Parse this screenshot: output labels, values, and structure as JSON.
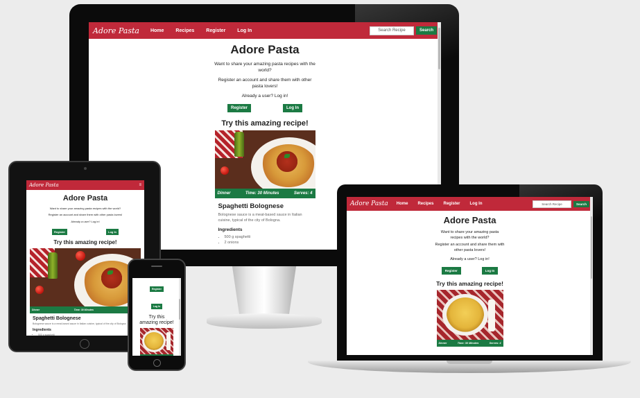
{
  "brand": "Adore Pasta",
  "nav": {
    "home": "Home",
    "recipes": "Recipes",
    "register": "Register",
    "login": "Log In"
  },
  "search": {
    "placeholder": "Search Recipe",
    "button": "Search"
  },
  "hero": {
    "title": "Adore Pasta",
    "intro": "Want to share your amazing pasta recipes with the world?",
    "register_prompt": "Register an account and share them with other pasta lovers!",
    "already_user": "Already a user? Log in!",
    "register_button": "Register",
    "login_button": "Log In"
  },
  "featured": {
    "heading": "Try this amazing recipe!",
    "meal": "Dinner",
    "time": "Time: 30 Minutes",
    "serves": "Serves: 4",
    "recipe_title": "Spaghetti Bolognese",
    "description": "Bolognese sauce is a meat-based sauce in Italian cuisine, typical of the city of Bologna.",
    "ingredients_label": "Ingredients",
    "ingredients": [
      "500 g spaghetti",
      "2 onions"
    ]
  },
  "phone_heading": [
    "Try this",
    "amazing recipe!"
  ],
  "colors": {
    "nav": "#c0293a",
    "button": "#1b7a43",
    "background": "#ececec"
  }
}
